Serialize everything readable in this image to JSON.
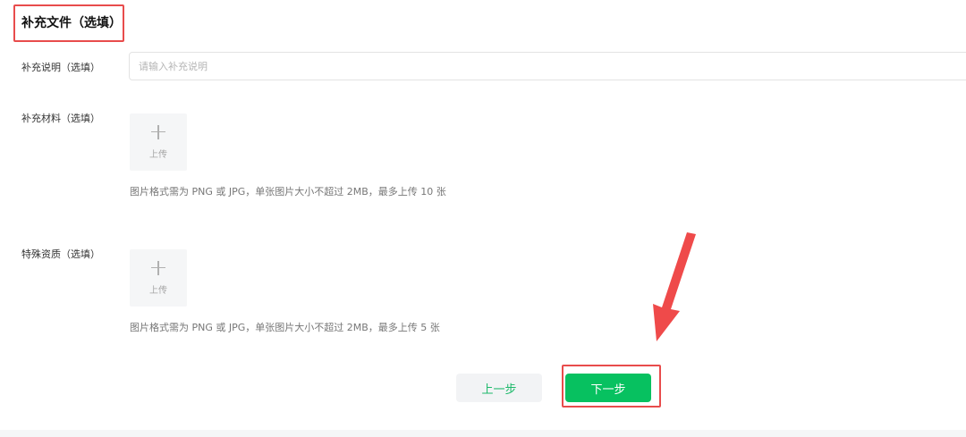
{
  "section": {
    "title": "补充文件（选填）"
  },
  "fields": {
    "description": {
      "label": "补充说明（选填）",
      "placeholder": "请输入补充说明",
      "value": ""
    },
    "materials": {
      "label": "补充材料（选填）",
      "upload_label": "上传",
      "hint": "图片格式需为 PNG 或 JPG，单张图片大小不超过 2MB，最多上传 10 张"
    },
    "qualification": {
      "label": "特殊资质（选填）",
      "upload_label": "上传",
      "hint": "图片格式需为 PNG 或 JPG，单张图片大小不超过 2MB，最多上传 5 张"
    }
  },
  "actions": {
    "prev_label": "上一步",
    "next_label": "下一步"
  },
  "colors": {
    "primary": "#07c160",
    "primary_text": "#1db96a",
    "annotation": "#e84c4c"
  }
}
